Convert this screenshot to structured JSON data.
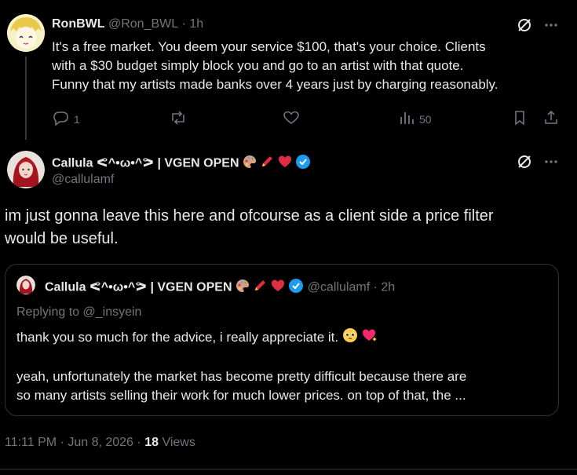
{
  "reply": {
    "name": "RonBWL",
    "handle": "@Ron_BWL",
    "time": "· 1h",
    "text_lines": [
      "It's a free market. You deem your service $100, that's your choice. Clients",
      "with a $30 budget simply block you and go to an artist with that quote.",
      "Funny that my artists made banks over 4 years just by charging reasonably."
    ],
    "replies_count": "1",
    "views_count": "50"
  },
  "main": {
    "name": "Callula ᕙ^•ω•^ᕗ | VGEN OPEN",
    "handle": "@callulamf",
    "text_lines": [
      "im just gonna leave this here and ofcourse as a client side a price filter",
      "would be useful."
    ]
  },
  "quote": {
    "name": "Callula ᕙ^•ω•^ᕗ | VGEN OPEN",
    "handle": "@callulamf",
    "time": "· 2h",
    "replying_to": "Replying to @_insyein",
    "line1": "thank you so much for the advice, i really appreciate it.",
    "line2": "yeah, unfortunately the market has become pretty difficult because there are",
    "line3": "so many artists selling their work for much lower prices. on top of that, the ..."
  },
  "meta": {
    "timestamp": "11:11 PM · Jun 8, 2026 ·",
    "views_count": "18",
    "views_label": "Views"
  },
  "colors": {
    "background": "#000000",
    "text": "#e7e9ea",
    "muted": "#71767b",
    "border": "#2f3336",
    "verified": "#1d9bf0"
  }
}
